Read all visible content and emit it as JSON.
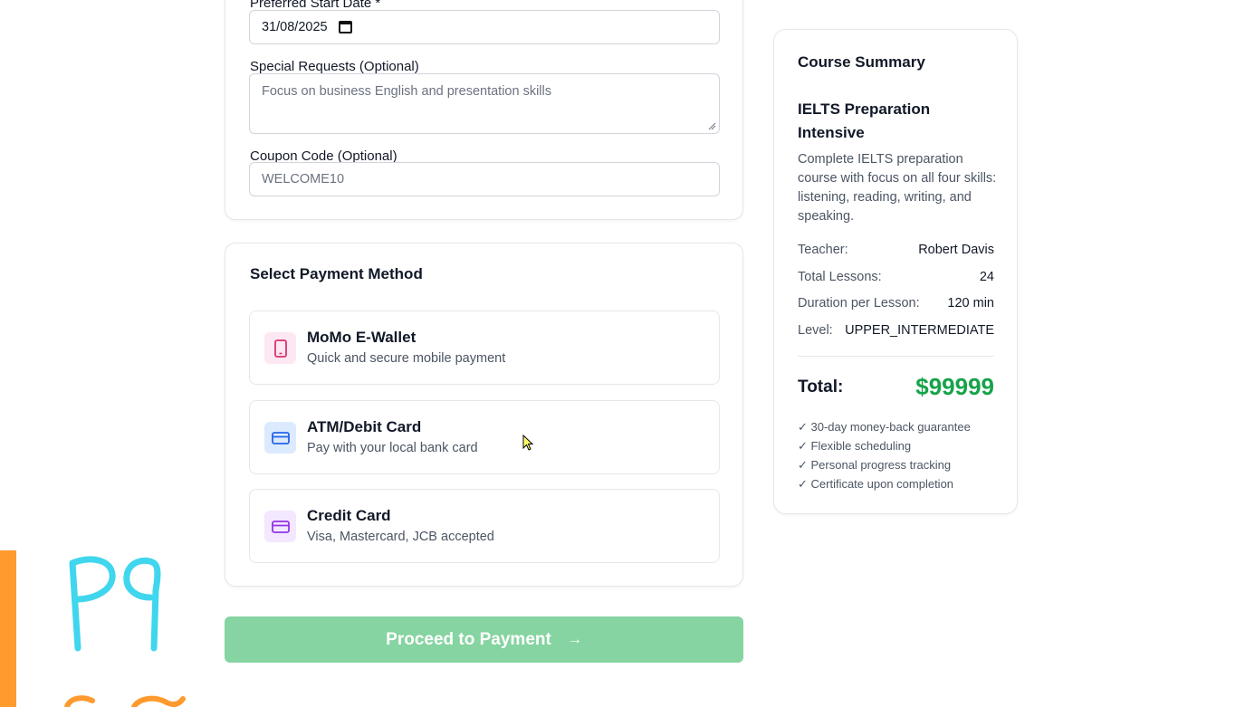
{
  "form": {
    "start_date_label": "Preferred Start Date *",
    "start_date_value": "31/08/2025",
    "special_requests_label": "Special Requests (Optional)",
    "special_requests_value": "Focus on business English and presentation skills",
    "coupon_label": "Coupon Code (Optional)",
    "coupon_placeholder": "WELCOME10"
  },
  "payment": {
    "title": "Select Payment Method",
    "methods": [
      {
        "name": "MoMo E-Wallet",
        "desc": "Quick and secure mobile payment",
        "icon": "phone-icon",
        "color": "#d6336c",
        "bg": "#fce7f3"
      },
      {
        "name": "ATM/Debit Card",
        "desc": "Pay with your local bank card",
        "icon": "card-icon",
        "color": "#2563eb",
        "bg": "#dbeafe"
      },
      {
        "name": "Credit Card",
        "desc": "Visa, Mastercard, JCB accepted",
        "icon": "card-icon",
        "color": "#9333ea",
        "bg": "#f3e8ff"
      }
    ]
  },
  "proceed_label": "Proceed to Payment",
  "proceed_arrow": "→",
  "summary": {
    "title": "Course Summary",
    "course_title": "IELTS Preparation Intensive",
    "course_desc": "Complete IELTS preparation course with focus on all four skills: listening, reading, writing, and speaking.",
    "rows": [
      {
        "k": "Teacher:",
        "v": "Robert Davis"
      },
      {
        "k": "Total Lessons:",
        "v": "24"
      },
      {
        "k": "Duration per Lesson:",
        "v": "120 min"
      },
      {
        "k": "Level:",
        "v": "UPPER_INTERMEDIATE"
      }
    ],
    "total_label": "Total:",
    "total_value": "$99999",
    "features": [
      "✓ 30-day money-back guarantee",
      "✓ Flexible scheduling",
      "✓ Personal progress tracking",
      "✓ Certificate upon completion"
    ]
  },
  "doodle_text": "P9",
  "colors": {
    "accent_green": "#16a34a",
    "button_green": "#86d4a1",
    "doodle_cyan": "#3fd6ee",
    "doodle_orange": "#ff9a2e"
  }
}
